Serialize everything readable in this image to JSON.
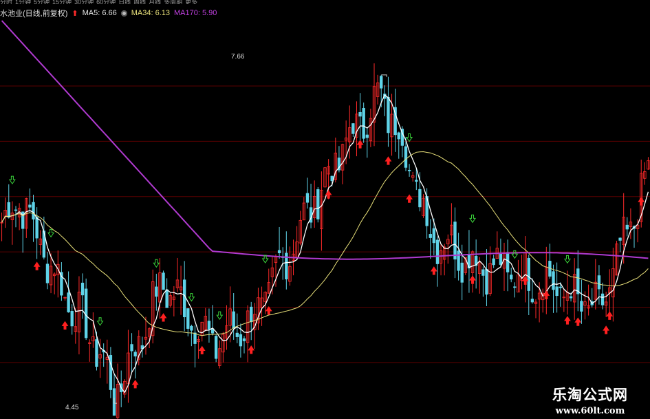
{
  "toolbar": {
    "items": [
      "分时",
      "1分钟",
      "5分钟",
      "15分钟",
      "30分钟",
      "60分钟",
      "日线",
      "周线",
      "月线",
      "多周期",
      "更多"
    ]
  },
  "legend": {
    "stock_name": "水池业(日线,前复权)",
    "ma5": "MA5: 6.66",
    "ma34": "MA34: 6.13",
    "ma170": "MA170: 5.90"
  },
  "colors": {
    "background": "#000000",
    "up_candle": "#ff2a2a",
    "down_candle": "#5fd3e8",
    "ma5": "#ffffff",
    "ma34": "#e8e07a",
    "ma170": "#b03ad0",
    "grid": "#5a0000",
    "buy_arrow": "#ff2020",
    "sell_arrow": "#3ad23a"
  },
  "price_labels": {
    "high": "7.66",
    "low": "4.45"
  },
  "watermark": {
    "title": "乐淘公式网",
    "url": "www.60lt.com"
  },
  "chart_data": {
    "type": "candlestick",
    "y_range": [
      4.3,
      8.2
    ],
    "candle_count": 185,
    "key_points": [
      {
        "index": 1,
        "close": 6.2
      },
      {
        "index": 5,
        "close": 6.45
      },
      {
        "index": 16,
        "close": 5.6
      },
      {
        "index": 28,
        "close": 4.9
      },
      {
        "index": 32,
        "close": 4.45
      },
      {
        "index": 46,
        "close": 5.6
      },
      {
        "index": 60,
        "close": 5.0
      },
      {
        "index": 72,
        "close": 5.25
      },
      {
        "index": 88,
        "close": 6.35
      },
      {
        "index": 100,
        "close": 7.1
      },
      {
        "index": 108,
        "close": 7.45
      },
      {
        "index": 114,
        "close": 7.0
      },
      {
        "index": 122,
        "close": 6.1
      },
      {
        "index": 135,
        "close": 5.8
      },
      {
        "index": 155,
        "close": 5.6
      },
      {
        "index": 170,
        "close": 5.3
      },
      {
        "index": 184,
        "close": 6.66
      }
    ],
    "ma5_last": 6.66,
    "ma34_last": 6.13,
    "ma170_last": 5.9,
    "high_marker": {
      "index": 108,
      "price": 7.66
    },
    "low_marker": {
      "index": 32,
      "price": 4.45
    },
    "buy_signals": [
      18,
      31,
      65,
      79,
      98,
      123,
      132,
      160,
      176,
      190,
      200,
      213,
      232,
      257,
      268,
      278,
      284,
      297,
      300,
      314
    ],
    "sell_signals": [
      6,
      24,
      49,
      76,
      93,
      107,
      130,
      201,
      232,
      253,
      279
    ]
  }
}
